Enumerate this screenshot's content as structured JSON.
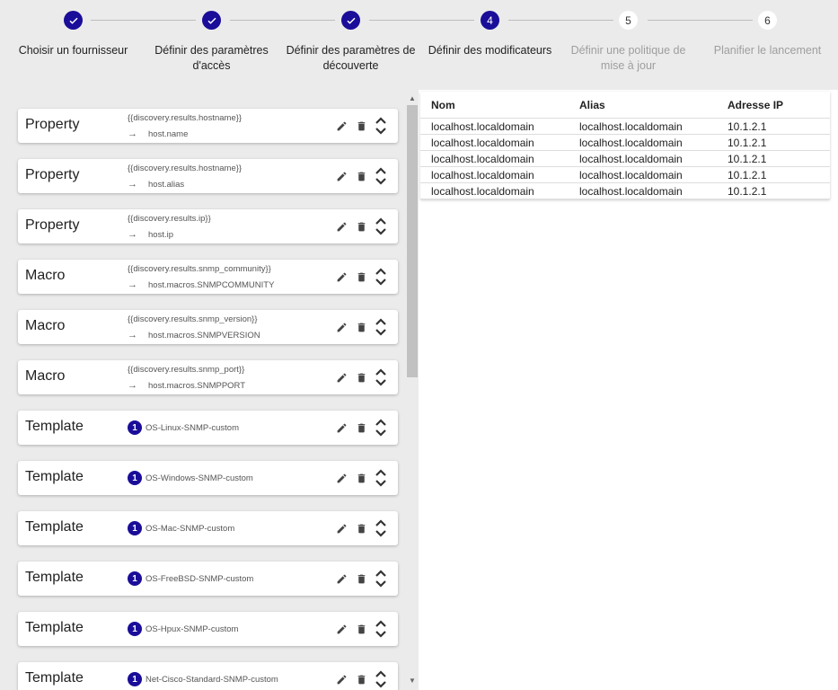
{
  "stepper": {
    "steps": [
      {
        "number": "1",
        "status": "done",
        "label": "Choisir un fournisseur"
      },
      {
        "number": "2",
        "status": "done",
        "label": "Définir des paramètres d'accès"
      },
      {
        "number": "3",
        "status": "done",
        "label": "Définir des paramètres de découverte"
      },
      {
        "number": "4",
        "status": "active",
        "label": "Définir des modificateurs"
      },
      {
        "number": "5",
        "status": "todo",
        "label": "Définir une politique de mise à jour"
      },
      {
        "number": "6",
        "status": "todo",
        "label": "Planifier le lancement"
      }
    ]
  },
  "modifiers": [
    {
      "type": "Property",
      "source": "{{discovery.results.hostname}}",
      "target": "host.name"
    },
    {
      "type": "Property",
      "source": "{{discovery.results.hostname}}",
      "target": "host.alias"
    },
    {
      "type": "Property",
      "source": "{{discovery.results.ip}}",
      "target": "host.ip"
    },
    {
      "type": "Macro",
      "source": "{{discovery.results.snmp_community}}",
      "target": "host.macros.SNMPCOMMUNITY"
    },
    {
      "type": "Macro",
      "source": "{{discovery.results.snmp_version}}",
      "target": "host.macros.SNMPVERSION"
    },
    {
      "type": "Macro",
      "source": "{{discovery.results.snmp_port}}",
      "target": "host.macros.SNMPPORT"
    },
    {
      "type": "Template",
      "badge": "1",
      "template": "OS-Linux-SNMP-custom"
    },
    {
      "type": "Template",
      "badge": "1",
      "template": "OS-Windows-SNMP-custom"
    },
    {
      "type": "Template",
      "badge": "1",
      "template": "OS-Mac-SNMP-custom"
    },
    {
      "type": "Template",
      "badge": "1",
      "template": "OS-FreeBSD-SNMP-custom"
    },
    {
      "type": "Template",
      "badge": "1",
      "template": "OS-Hpux-SNMP-custom"
    },
    {
      "type": "Template",
      "badge": "1",
      "template": "Net-Cisco-Standard-SNMP-custom"
    }
  ],
  "icons": {
    "arrow": "→",
    "edit": "pencil-icon",
    "delete": "trash-icon",
    "reorder": "unfold-icon",
    "check": "check-icon",
    "scroll_up": "▲",
    "scroll_down": "▼"
  },
  "results": {
    "columns": [
      "Nom",
      "Alias",
      "Adresse IP"
    ],
    "rows": [
      [
        "localhost.localdomain",
        "localhost.localdomain",
        "10.1.2.1"
      ],
      [
        "localhost.localdomain",
        "localhost.localdomain",
        "10.1.2.1"
      ],
      [
        "localhost.localdomain",
        "localhost.localdomain",
        "10.1.2.1"
      ],
      [
        "localhost.localdomain",
        "localhost.localdomain",
        "10.1.2.1"
      ],
      [
        "localhost.localdomain",
        "localhost.localdomain",
        "10.1.2.1"
      ]
    ]
  },
  "colors": {
    "accent": "#1a0d99",
    "background": "#ebebeb",
    "card": "#ffffff"
  }
}
